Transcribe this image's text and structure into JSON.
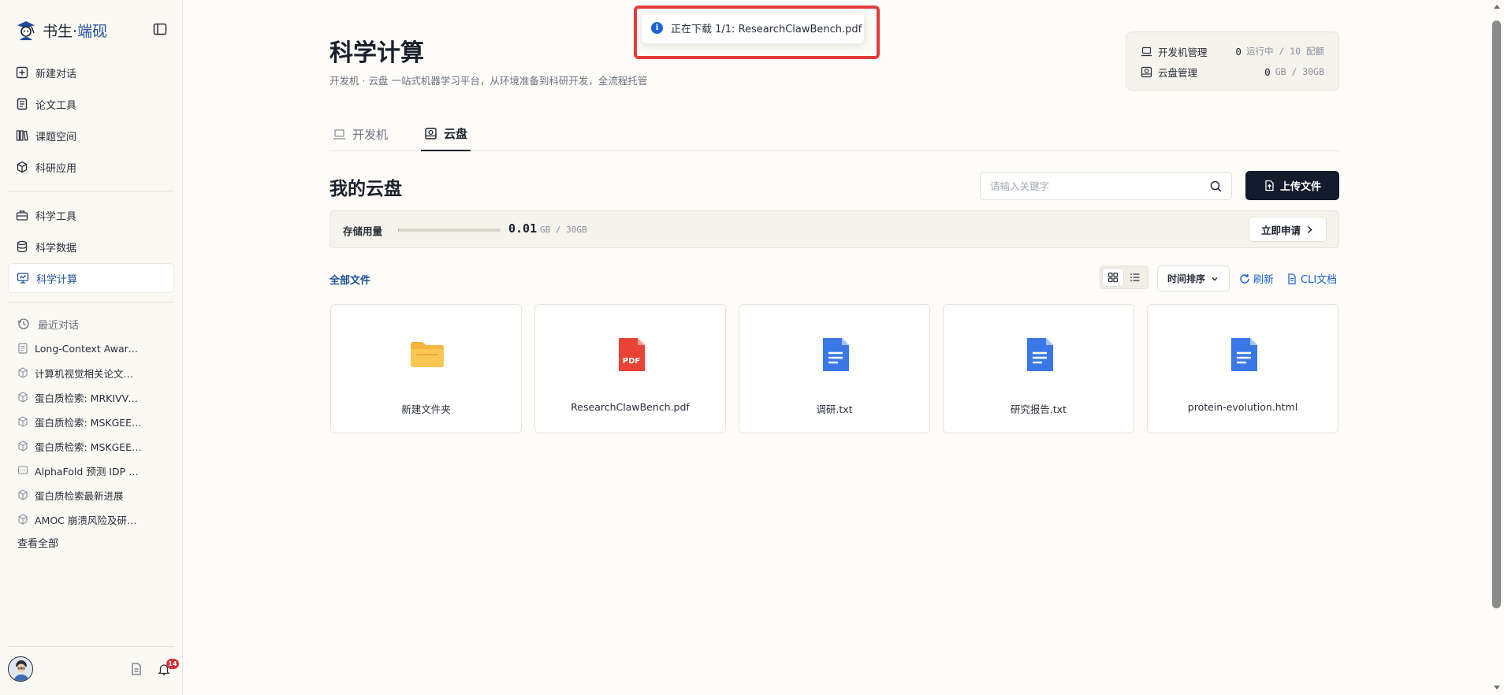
{
  "sidebar": {
    "brand": {
      "name": "书生",
      "separator": "·",
      "accent": "端砚"
    },
    "nav_top": [
      {
        "label": "新建对话",
        "icon": "plus-square-icon"
      },
      {
        "label": "论文工具",
        "icon": "document-icon"
      },
      {
        "label": "课题空间",
        "icon": "library-icon"
      },
      {
        "label": "科研应用",
        "icon": "cube-icon"
      }
    ],
    "nav_bottom": [
      {
        "label": "科学工具",
        "icon": "toolbox-icon"
      },
      {
        "label": "科学数据",
        "icon": "database-icon"
      },
      {
        "label": "科学计算",
        "icon": "monitor-icon",
        "active": true
      }
    ],
    "recent": {
      "title": "最近对话",
      "items": [
        {
          "label": "Long-Context Aware …",
          "icon": "document-icon"
        },
        {
          "label": "计算机视觉相关论文…",
          "icon": "cube-icon"
        },
        {
          "label": "蛋白质检索: MRKIVVA…",
          "icon": "cube-icon"
        },
        {
          "label": "蛋白质检索: MSKGEE…",
          "icon": "cube-icon"
        },
        {
          "label": "蛋白质检索: MSKGEE…",
          "icon": "cube-icon"
        },
        {
          "label": "AlphaFold 预测 IDP …",
          "icon": "chat-icon"
        },
        {
          "label": "蛋白质检索最新进展",
          "icon": "cube-icon"
        },
        {
          "label": "AMOC 崩溃风险及研…",
          "icon": "cube-icon"
        }
      ],
      "see_all": "查看全部"
    },
    "notification_count": "14"
  },
  "header": {
    "title": "科学计算",
    "subtitle": "开发机 · 云盘 一站式机器学习平台，从环境准备到科研开发，全流程托管"
  },
  "stats": {
    "devbox": {
      "label": "开发机管理",
      "value": "0",
      "unit": "运行中 / 10 配额"
    },
    "cloud": {
      "label": "云盘管理",
      "value": "0",
      "unit": "GB / 30GB"
    }
  },
  "tabs": [
    {
      "label": "开发机",
      "active": false
    },
    {
      "label": "云盘",
      "active": true
    }
  ],
  "drive": {
    "title": "我的云盘",
    "search_placeholder": "请输入关键字",
    "upload_label": "上传文件",
    "storage": {
      "label": "存储用量",
      "used": "0.01",
      "total": "GB / 30GB",
      "fraction": 0.0003,
      "apply_label": "立即申请"
    },
    "files_label": "全部文件",
    "sort_label": "时间排序",
    "refresh_label": "刷新",
    "cli_label": "CLI文档",
    "files": [
      {
        "name": "新建文件夹",
        "type": "folder"
      },
      {
        "name": "ResearchClawBench.pdf",
        "type": "pdf"
      },
      {
        "name": "调研.txt",
        "type": "doc"
      },
      {
        "name": "研究报告.txt",
        "type": "doc"
      },
      {
        "name": "protein-evolution.html",
        "type": "doc"
      }
    ]
  },
  "toast": {
    "icon": "i",
    "message": "正在下载 1/1: ResearchClawBench.pdf"
  },
  "colors": {
    "accent": "#1d4e9a",
    "link": "#1d62d6",
    "primary_button": "#141b2c",
    "highlight": "#e23c3c",
    "pdf_red": "#ea4335",
    "folder_yellow": "#f6b43d",
    "doc_blue": "#3b78e7"
  }
}
